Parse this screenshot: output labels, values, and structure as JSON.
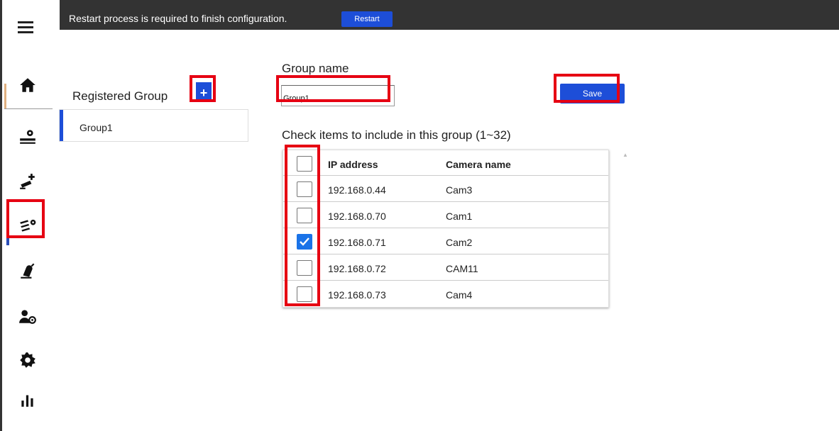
{
  "topbar": {
    "message": "Restart process is required to finish configuration.",
    "restart_label": "Restart"
  },
  "sidebar": {
    "items": [
      {
        "icon": "home-icon"
      },
      {
        "icon": "recorder-settings-icon"
      },
      {
        "icon": "add-camera-icon"
      },
      {
        "icon": "camera-group-settings-icon"
      },
      {
        "icon": "event-icon"
      },
      {
        "icon": "user-settings-icon"
      },
      {
        "icon": "gear-icon"
      },
      {
        "icon": "statistics-icon"
      }
    ]
  },
  "registered": {
    "title": "Registered Group",
    "add_label": "+",
    "groups": [
      "Group1"
    ]
  },
  "form": {
    "group_name_label": "Group name",
    "group_name_value": "Group1",
    "save_label": "Save",
    "check_title": "Check items to include in this group (1~32)"
  },
  "table": {
    "headers": {
      "ip": "IP address",
      "name": "Camera name"
    },
    "rows": [
      {
        "ip": "192.168.0.44",
        "name": "Cam3",
        "checked": false
      },
      {
        "ip": "192.168.0.70",
        "name": "Cam1",
        "checked": false
      },
      {
        "ip": "192.168.0.71",
        "name": "Cam2",
        "checked": true
      },
      {
        "ip": "192.168.0.72",
        "name": "CAM11",
        "checked": false
      },
      {
        "ip": "192.168.0.73",
        "name": "Cam4",
        "checked": false
      }
    ]
  },
  "colors": {
    "accent": "#1d4ed8",
    "topbar": "#333333",
    "highlight": "#e60012",
    "checkbox_checked": "#1a73e8"
  }
}
